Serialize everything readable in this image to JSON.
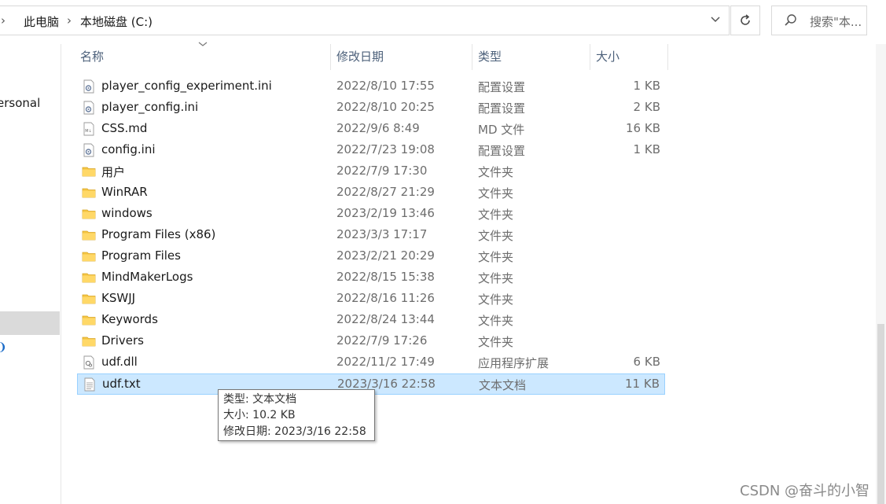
{
  "breadcrumb": {
    "items": [
      "此电脑",
      "本地磁盘 (C:)"
    ]
  },
  "search": {
    "placeholder": "搜索\"本..."
  },
  "nav": {
    "personal_label": "ersonal"
  },
  "columns": {
    "name": "名称",
    "date": "修改日期",
    "type": "类型",
    "size": "大小"
  },
  "files": [
    {
      "name": "player_config_experiment.ini",
      "date": "2022/8/10 17:55",
      "type": "配置设置",
      "size": "1 KB",
      "icon": "settings-file-icon"
    },
    {
      "name": "player_config.ini",
      "date": "2022/8/10 20:25",
      "type": "配置设置",
      "size": "2 KB",
      "icon": "settings-file-icon"
    },
    {
      "name": "CSS.md",
      "date": "2022/9/6 8:49",
      "type": "MD 文件",
      "size": "16 KB",
      "icon": "markdown-file-icon"
    },
    {
      "name": "config.ini",
      "date": "2022/7/23 19:08",
      "type": "配置设置",
      "size": "1 KB",
      "icon": "settings-file-icon"
    },
    {
      "name": "用户",
      "date": "2022/7/9 17:30",
      "type": "文件夹",
      "size": "",
      "icon": "folder-icon"
    },
    {
      "name": "WinRAR",
      "date": "2022/8/27 21:29",
      "type": "文件夹",
      "size": "",
      "icon": "folder-icon"
    },
    {
      "name": "windows",
      "date": "2023/2/19 13:46",
      "type": "文件夹",
      "size": "",
      "icon": "folder-icon"
    },
    {
      "name": "Program Files (x86)",
      "date": "2023/3/3 17:17",
      "type": "文件夹",
      "size": "",
      "icon": "folder-icon"
    },
    {
      "name": "Program Files",
      "date": "2023/2/21 20:29",
      "type": "文件夹",
      "size": "",
      "icon": "folder-icon"
    },
    {
      "name": "MindMakerLogs",
      "date": "2022/8/15 15:38",
      "type": "文件夹",
      "size": "",
      "icon": "folder-icon"
    },
    {
      "name": "KSWJJ",
      "date": "2022/8/16 11:26",
      "type": "文件夹",
      "size": "",
      "icon": "folder-icon"
    },
    {
      "name": "Keywords",
      "date": "2022/8/24 13:44",
      "type": "文件夹",
      "size": "",
      "icon": "folder-icon"
    },
    {
      "name": "Drivers",
      "date": "2022/7/9 17:26",
      "type": "文件夹",
      "size": "",
      "icon": "folder-icon"
    },
    {
      "name": "udf.dll",
      "date": "2022/11/2 17:49",
      "type": "应用程序扩展",
      "size": "6 KB",
      "icon": "dll-file-icon"
    },
    {
      "name": "udf.txt",
      "date": "2023/3/16 22:58",
      "type": "文本文档",
      "size": "11 KB",
      "icon": "text-file-icon",
      "selected": true
    }
  ],
  "tooltip": {
    "type_line": "类型: 文本文档",
    "size_line": "大小: 10.2 KB",
    "date_line": "修改日期: 2023/3/16 22:58"
  },
  "watermark": "CSDN @奋斗的小智",
  "colors": {
    "selection_bg": "#cce8ff",
    "selection_border": "#99d1ff",
    "folder": "#f4c542",
    "header_text": "#4c607a"
  }
}
